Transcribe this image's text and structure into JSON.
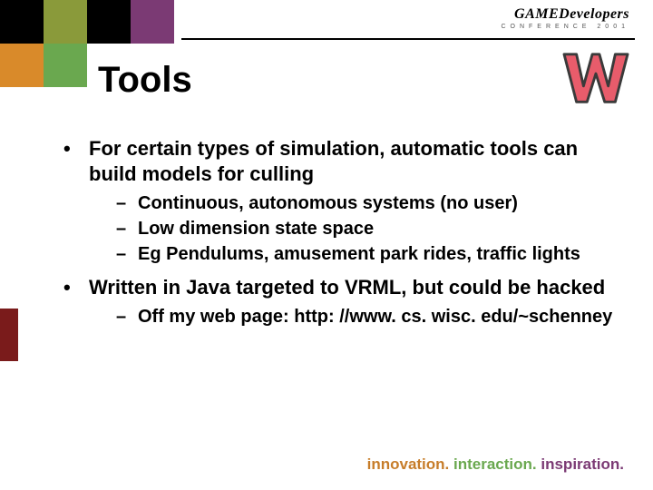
{
  "brand": {
    "top": "GAMEDevelopers",
    "sub": "CONFERENCE 2001"
  },
  "title": "Tools",
  "bullets": [
    {
      "text": "For certain types of simulation, automatic tools can build models for culling",
      "sub": [
        "Continuous, autonomous systems (no user)",
        "Low dimension state space",
        "Eg Pendulums, amusement park rides, traffic lights"
      ]
    },
    {
      "text": "Written in Java targeted to VRML, but could be hacked",
      "sub": [
        "Off my web page: http: //www. cs. wisc. edu/~schenney"
      ]
    }
  ],
  "footer": {
    "w1": "innovation.",
    "w2": "interaction.",
    "w3": "inspiration."
  },
  "logo_letter": "W"
}
